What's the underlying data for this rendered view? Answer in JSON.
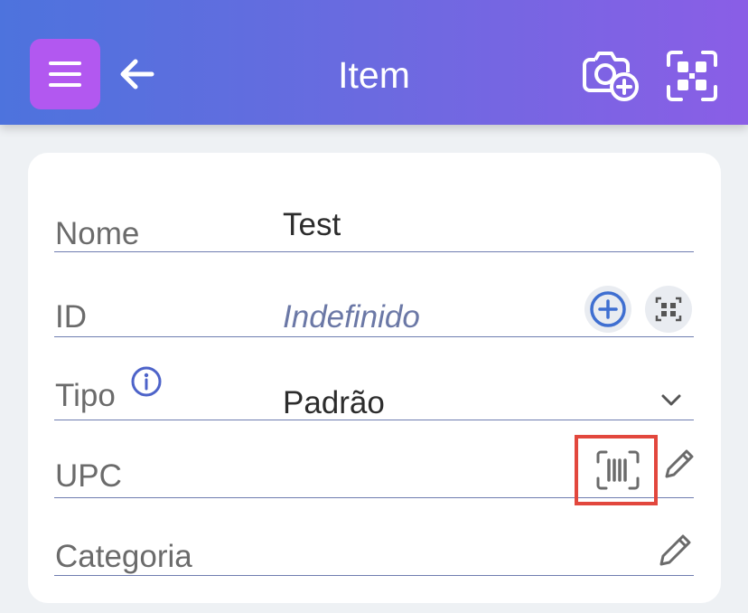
{
  "header": {
    "title": "Item",
    "icons": {
      "menu": "menu-icon",
      "back": "arrow-left-icon",
      "camera_add": "camera-add-icon",
      "scan": "qr-scan-icon"
    },
    "colors": {
      "gradient_start": "#4d73dd",
      "gradient_end": "#8a5ee6",
      "menu_button": "#b258f0"
    }
  },
  "form": {
    "fields": {
      "nome": {
        "label": "Nome",
        "value": "Test"
      },
      "id": {
        "label": "ID",
        "placeholder": "Indefinido",
        "icons": [
          "plus-circle-icon",
          "qr-code-icon"
        ]
      },
      "tipo": {
        "label": "Tipo",
        "value": "Padrão",
        "icons": [
          "info-icon",
          "chevron-down-icon"
        ]
      },
      "upc": {
        "label": "UPC",
        "value": "",
        "icons": [
          "barcode-scan-icon",
          "pencil-icon"
        ]
      },
      "categoria": {
        "label": "Categoria",
        "value": "",
        "icons": [
          "pencil-icon"
        ]
      }
    }
  },
  "colors": {
    "accent": "#3f6fd1",
    "highlight": "#e2473d",
    "underline": "#6f7db0"
  }
}
